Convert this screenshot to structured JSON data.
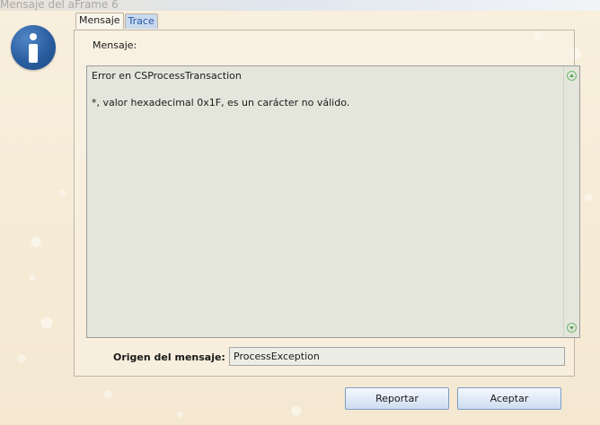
{
  "window": {
    "title": "Mensaje del aFrame 6"
  },
  "icon": {
    "name": "info-icon",
    "color": "#2a5d9f"
  },
  "tabs": [
    {
      "label": "Mensaje",
      "active": true
    },
    {
      "label": "Trace",
      "active": false
    }
  ],
  "message": {
    "label": "Mensaje:",
    "line1": "Error en CSProcessTransaction",
    "line2": "*, valor hexadecimal 0x1F, es un carácter no válido."
  },
  "origin": {
    "label": "Origen del mensaje:",
    "value": "ProcessException"
  },
  "buttons": {
    "report": "Reportar",
    "accept": "Aceptar"
  },
  "scrollbar_icons": [
    "scroll-up-icon",
    "scroll-down-icon"
  ]
}
